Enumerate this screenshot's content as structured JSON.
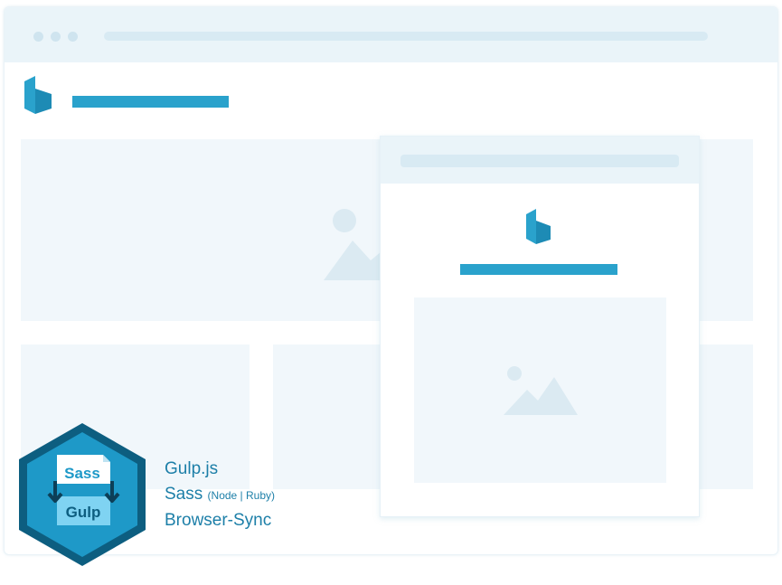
{
  "badge": {
    "top_label": "Sass",
    "bottom_label": "Gulp"
  },
  "features": {
    "item1": "Gulp.js",
    "item2_main": "Sass",
    "item2_note": "(Node | Ruby)",
    "item3": "Browser-Sync"
  },
  "icons": {
    "site_logo": "brand-logo-icon",
    "hero_image": "image-placeholder-icon",
    "mobile_logo": "brand-logo-icon",
    "mobile_image": "image-placeholder-icon",
    "arrows": "download-arrow-icon"
  },
  "colors": {
    "accent": "#2aa2cc",
    "badge_outer": "#0d5e80",
    "badge_inner": "#1e99c8",
    "text": "#1d7fa8"
  }
}
